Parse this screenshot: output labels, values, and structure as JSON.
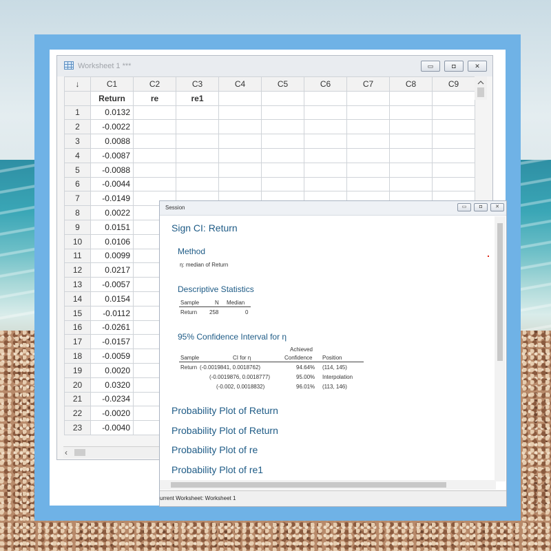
{
  "worksheet": {
    "title": "Worksheet 1 ***",
    "buttons": {
      "minimize": "▭",
      "restore": "◘",
      "close": "✕"
    },
    "columns": [
      "C1",
      "C2",
      "C3",
      "C4",
      "C5",
      "C6",
      "C7",
      "C8",
      "C9"
    ],
    "names": [
      "Return",
      "re",
      "re1",
      "",
      "",
      "",
      "",
      "",
      ""
    ],
    "rows": [
      {
        "n": "1",
        "v": "0.0132"
      },
      {
        "n": "2",
        "v": "-0.0022"
      },
      {
        "n": "3",
        "v": "0.0088"
      },
      {
        "n": "4",
        "v": "-0.0087"
      },
      {
        "n": "5",
        "v": "-0.0088"
      },
      {
        "n": "6",
        "v": "-0.0044"
      },
      {
        "n": "7",
        "v": "-0.0149"
      },
      {
        "n": "8",
        "v": "0.0022"
      },
      {
        "n": "9",
        "v": "0.0151"
      },
      {
        "n": "10",
        "v": "0.0106"
      },
      {
        "n": "11",
        "v": "0.0099"
      },
      {
        "n": "12",
        "v": "0.0217"
      },
      {
        "n": "13",
        "v": "-0.0057"
      },
      {
        "n": "14",
        "v": "0.0154"
      },
      {
        "n": "15",
        "v": "-0.0112"
      },
      {
        "n": "16",
        "v": "-0.0261"
      },
      {
        "n": "17",
        "v": "-0.0157"
      },
      {
        "n": "18",
        "v": "-0.0059"
      },
      {
        "n": "19",
        "v": "0.0020"
      },
      {
        "n": "20",
        "v": "0.0320"
      },
      {
        "n": "21",
        "v": "-0.0234"
      },
      {
        "n": "22",
        "v": "-0.0020"
      },
      {
        "n": "23",
        "v": "-0.0040"
      }
    ]
  },
  "session": {
    "title": "Session",
    "heading": "Sign CI: Return",
    "method_title": "Method",
    "method_text": "η: median of Return",
    "desc_title": "Descriptive Statistics",
    "desc_headers": [
      "Sample",
      "N",
      "Median"
    ],
    "desc_row": [
      "Return",
      "258",
      "0"
    ],
    "ci_title": "95% Confidence Interval for η",
    "ci_header_achieved": "Achieved",
    "ci_headers": [
      "Sample",
      "CI for η",
      "Confidence",
      "Position"
    ],
    "ci_sample": "Return",
    "ci_rows": [
      {
        "ci": "(-0.0019841, 0.0018762)",
        "conf": "94.64%",
        "pos": "(114, 145)"
      },
      {
        "ci": "(-0.0019876, 0.0018777)",
        "conf": "95.00%",
        "pos": "Interpolation"
      },
      {
        "ci": "(-0.002, 0.0018832)",
        "conf": "96.01%",
        "pos": "(113, 146)"
      }
    ],
    "plots": [
      "Probability Plot of Return",
      "Probability Plot of Return",
      "Probability Plot of re",
      "Probability Plot of re1"
    ],
    "status": "urrent Worksheet: Worksheet 1"
  }
}
